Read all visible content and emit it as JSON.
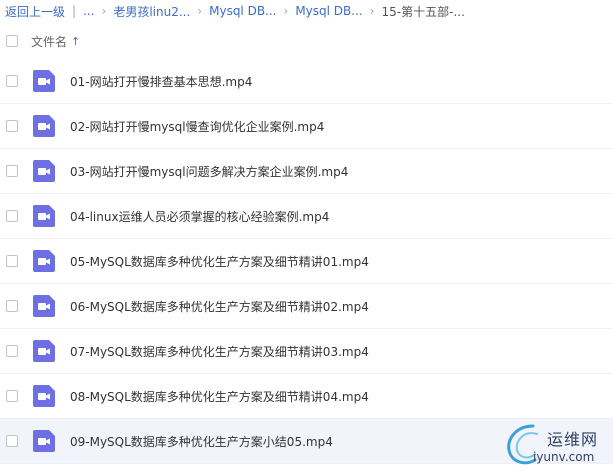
{
  "breadcrumb": {
    "back": "返回上一级",
    "ellipsis": "...",
    "crumbs": [
      "老男孩linu2...",
      "Mysql DB...",
      "Mysql DB..."
    ],
    "current": "15-第十五部-..."
  },
  "header": {
    "name_label": "文件名",
    "sort_icon": "arrow-up-icon"
  },
  "files": [
    {
      "name": "01-网站打开慢排查基本思想.mp4"
    },
    {
      "name": "02-网站打开慢mysql慢查询优化企业案例.mp4"
    },
    {
      "name": "03-网站打开慢mysql问题多解决方案企业案例.mp4"
    },
    {
      "name": "04-linux运维人员必须掌握的核心经验案例.mp4"
    },
    {
      "name": "05-MySQL数据库多种优化生产方案及细节精讲01.mp4"
    },
    {
      "name": "06-MySQL数据库多种优化生产方案及细节精讲02.mp4"
    },
    {
      "name": "07-MySQL数据库多种优化生产方案及细节精讲03.mp4"
    },
    {
      "name": "08-MySQL数据库多种优化生产方案及细节精讲04.mp4"
    },
    {
      "name": "09-MySQL数据库多种优化生产方案小结05.mp4"
    }
  ],
  "file_icon": "video-file-icon",
  "colors": {
    "link": "#3b6cc8",
    "video_icon": "#6e6fe3",
    "highlight_row": "#f1f5fb"
  },
  "watermark": {
    "brand": "运维网",
    "domain": "iyunv.com"
  }
}
